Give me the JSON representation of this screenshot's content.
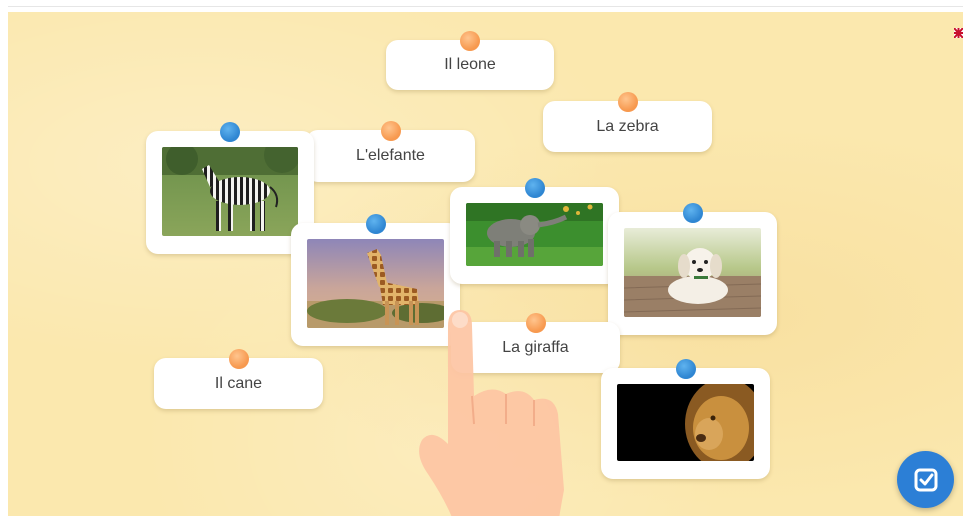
{
  "activity": {
    "words": [
      {
        "id": "leone",
        "label": "Il leone"
      },
      {
        "id": "zebra",
        "label": "La zebra"
      },
      {
        "id": "elefante",
        "label": "L'elefante"
      },
      {
        "id": "giraffa",
        "label": "La giraffa"
      },
      {
        "id": "cane",
        "label": "Il cane"
      }
    ],
    "images": [
      {
        "id": "zebra",
        "icon": "zebra-photo"
      },
      {
        "id": "giraffa",
        "icon": "giraffe-photo"
      },
      {
        "id": "elefante",
        "icon": "elephant-photo"
      },
      {
        "id": "cane",
        "icon": "puppy-photo"
      },
      {
        "id": "leone",
        "icon": "lion-photo"
      }
    ]
  },
  "colors": {
    "background": "#fbe8ae",
    "word_pin": "#f7994f",
    "image_pin": "#2f86d2",
    "check_button": "#2c7fd6"
  },
  "icons": {
    "check_button": "check-icon",
    "language_flag": "flag-icon",
    "hint": "pointing-hand-icon"
  }
}
